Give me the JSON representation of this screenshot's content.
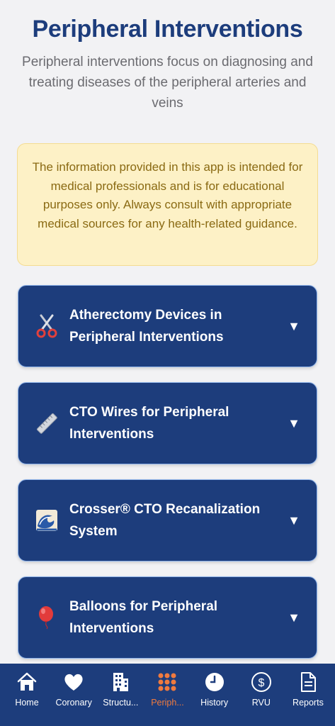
{
  "header": {
    "title": "Peripheral Interventions",
    "subtitle": "Peripheral interventions focus on diagnosing and treating diseases of the peripheral arteries and veins"
  },
  "disclaimer": {
    "text": "The information provided in this app is intended for medical professionals and is for educational purposes only. Always consult with appropriate medical sources for any health-related guidance."
  },
  "sections": [
    {
      "icon": "scissors-icon",
      "label": "Atherectomy Devices in Peripheral Interventions",
      "chevron": "▼"
    },
    {
      "icon": "ruler-icon",
      "label": "CTO Wires for Peripheral Interventions",
      "chevron": "▼"
    },
    {
      "icon": "wave-icon",
      "label": "Crosser® CTO Recanalization System",
      "chevron": "▼"
    },
    {
      "icon": "balloon-icon",
      "label": "Balloons for Peripheral Interventions",
      "chevron": "▼"
    }
  ],
  "tabbar": {
    "active_color": "#f07a3e",
    "background": "#1d3d7c",
    "tabs": [
      {
        "icon": "home-icon",
        "label": "Home"
      },
      {
        "icon": "heart-icon",
        "label": "Coronary"
      },
      {
        "icon": "building-icon",
        "label": "Structu..."
      },
      {
        "icon": "grid-icon",
        "label": "Periph...",
        "active": true
      },
      {
        "icon": "clock-icon",
        "label": "History"
      },
      {
        "icon": "dollar-icon",
        "label": "RVU"
      },
      {
        "icon": "document-icon",
        "label": "Reports"
      }
    ]
  }
}
